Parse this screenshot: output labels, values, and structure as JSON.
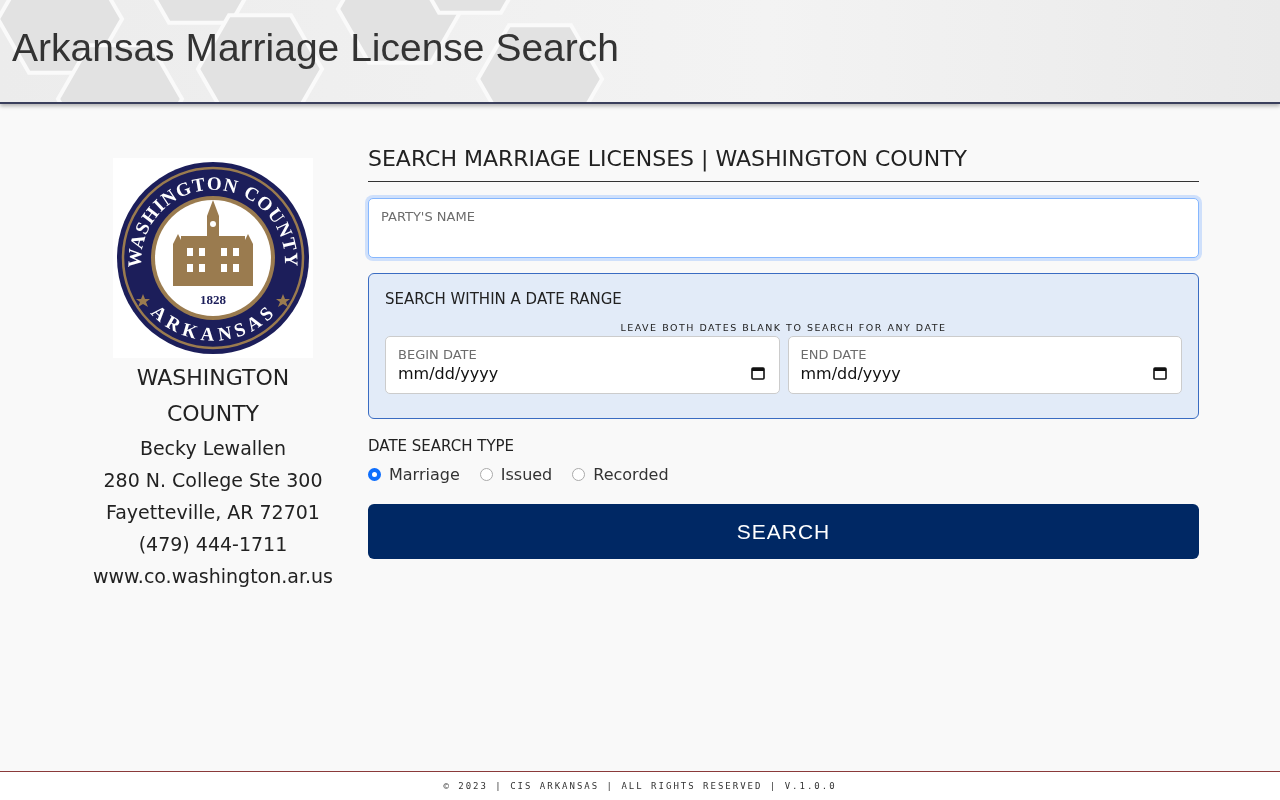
{
  "header": {
    "title": "Arkansas Marriage License Search"
  },
  "county": {
    "seal": {
      "top_text": "WASHINGTON COUNTY",
      "bottom_text": "ARKANSAS",
      "year": "1828"
    },
    "name": "WASHINGTON COUNTY",
    "contact_lines": [
      "Becky Lewallen",
      "280 N. College Ste 300",
      "Fayetteville, AR 72701",
      "(479) 444-1711",
      "www.co.washington.ar.us"
    ]
  },
  "search": {
    "heading": "SEARCH MARRIAGE LICENSES | WASHINGTON COUNTY",
    "name_field": {
      "label": "PARTY'S NAME",
      "focused": true
    },
    "date_range": {
      "title": "SEARCH WITHIN A DATE RANGE",
      "hint": "LEAVE BOTH DATES BLANK TO SEARCH FOR ANY DATE",
      "fields": [
        {
          "label": "BEGIN DATE",
          "placeholder": "mm/dd/yyyy"
        },
        {
          "label": "END DATE",
          "placeholder": "mm/dd/yyyy"
        }
      ]
    },
    "date_type": {
      "label": "DATE SEARCH TYPE",
      "options": [
        {
          "label": "Marriage",
          "selected": true
        },
        {
          "label": "Issued",
          "selected": false
        },
        {
          "label": "Recorded",
          "selected": false
        }
      ]
    },
    "button": "SEARCH"
  },
  "footer": "© 2023 | CIS ARKANSAS | ALL RIGHTS RESERVED | V.1.0.0"
}
